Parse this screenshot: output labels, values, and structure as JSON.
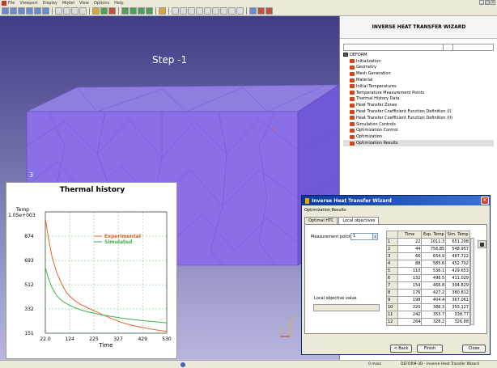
{
  "menubar": {
    "items": [
      "File",
      "Viewport",
      "Display",
      "Model",
      "View",
      "Options",
      "Help"
    ],
    "window_buttons": [
      "_",
      "□",
      "×"
    ]
  },
  "viewport": {
    "step_label": "Step  -1",
    "corner_number": "3",
    "axis_z": "z",
    "axis_x": "x"
  },
  "thermal_history": {
    "title": "Thermal history",
    "legend": [
      "Experimental",
      "Simulated"
    ],
    "colors": {
      "experimental": "#e8602c",
      "simulated": "#3fb04a",
      "grid": "#3fb04a"
    }
  },
  "chart_data": {
    "type": "line",
    "title": "Thermal history",
    "xlabel": "Time",
    "ylabel": "Temp",
    "ylabel_scale": "1.05e+003",
    "xlim": [
      22.0,
      530
    ],
    "ylim": [
      151,
      1055
    ],
    "x_ticks": [
      "22.0",
      "124",
      "225",
      "327",
      "429",
      "530"
    ],
    "y_ticks": [
      "874",
      "693",
      "512",
      "332",
      "151"
    ],
    "series": [
      {
        "name": "Experimental",
        "x": [
          22,
          35,
          50,
          70,
          90,
          110,
          140,
          170,
          200,
          230,
          260,
          300,
          340,
          380,
          420,
          460,
          500,
          530
        ],
        "y": [
          1005,
          860,
          720,
          600,
          520,
          455,
          400,
          365,
          340,
          315,
          290,
          260,
          232,
          212,
          196,
          183,
          172,
          164
        ]
      },
      {
        "name": "Simulated",
        "x": [
          22,
          35,
          50,
          70,
          90,
          110,
          140,
          170,
          200,
          230,
          260,
          300,
          340,
          380,
          420,
          460,
          500,
          530
        ],
        "y": [
          640,
          560,
          490,
          430,
          395,
          372,
          345,
          325,
          310,
          298,
          287,
          275,
          264,
          255,
          247,
          240,
          233,
          228
        ]
      }
    ],
    "grid": true,
    "legend_position": "upper-right"
  },
  "right_panel": {
    "title": "INVERSE HEAT TRANSFER WIZARD",
    "tree_root": "DEFORM",
    "tree_items": [
      "Initialization",
      "Geometry",
      "Mesh Generation",
      "Material",
      "Initial Temperatures",
      "Temperature Measurement Points",
      "Thermal History Data",
      "Heat Transfer Zones",
      "Heat Transfer Coefficient Function Definition (I)",
      "Heat Transfer Coefficient Function Definition (II)",
      "Simulation Controls",
      "Optimization Control",
      "Optimization",
      "Optimization Results"
    ]
  },
  "dialog": {
    "title": "Inverse Heat Transfer Wizard",
    "subtitle": "Optimization Results",
    "tabs": [
      "Optimal HTC",
      "Local objectives"
    ],
    "active_tab": 1,
    "measurement_point_label": "Measurement point",
    "measurement_point_value": "1",
    "local_objective_label": "Local objective value",
    "table": {
      "headers": [
        "",
        "Time",
        "Exp. Temp",
        "Sim. Temp"
      ],
      "rows": [
        [
          "1",
          "22",
          "1011.3",
          "651.208"
        ],
        [
          "2",
          "44",
          "756.85",
          "548.957"
        ],
        [
          "3",
          "66",
          "654.9",
          "487.722"
        ],
        [
          "4",
          "88",
          "585.6",
          "452.702"
        ],
        [
          "5",
          "110",
          "536.1",
          "429.653"
        ],
        [
          "6",
          "132",
          "496.5",
          "411.029"
        ],
        [
          "7",
          "154",
          "466.8",
          "394.829"
        ],
        [
          "8",
          "176",
          "427.2",
          "380.812"
        ],
        [
          "9",
          "198",
          "404.4",
          "367.061"
        ],
        [
          "10",
          "220",
          "388.3",
          "353.127"
        ],
        [
          "11",
          "242",
          "353.7",
          "338.77"
        ],
        [
          "12",
          "264",
          "328.2",
          "326.88"
        ]
      ]
    },
    "buttons": {
      "back": "< Back",
      "finish": "Finish",
      "close": "Close"
    }
  },
  "status": {
    "time": "0 msec",
    "app": "DEFORM-3D  -  Inverse Heat Transfer Wizard"
  }
}
